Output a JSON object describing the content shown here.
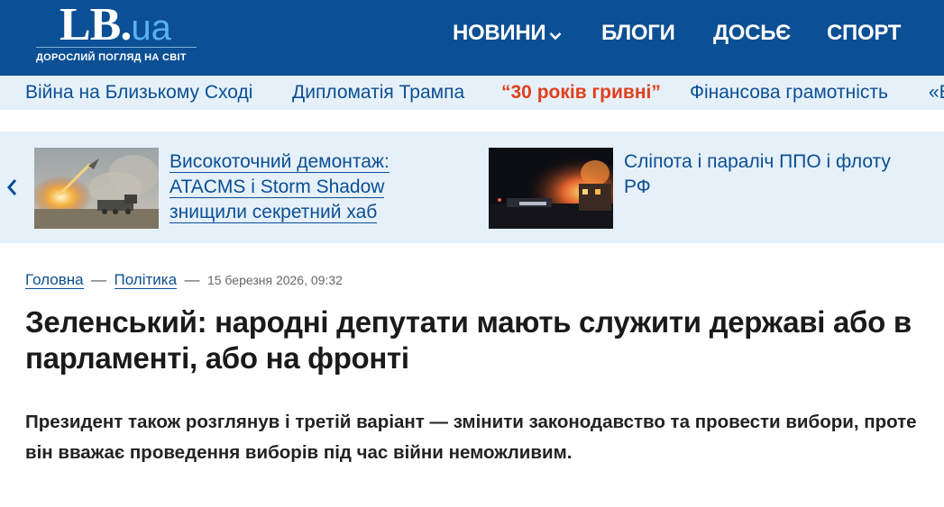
{
  "header": {
    "logo_main": "LB",
    "logo_dot": ".",
    "logo_ua": "ua",
    "logo_tagline": "ДОРОСЛИЙ ПОГЛЯД НА СВІТ",
    "nav": [
      {
        "label": "НОВИНИ",
        "has_dropdown": true
      },
      {
        "label": "БЛОГИ"
      },
      {
        "label": "ДОСЬЄ"
      },
      {
        "label": "СПОРТ"
      }
    ]
  },
  "topics": [
    {
      "label": "Війна на Близькому Сході"
    },
    {
      "label": "Дипломатія Трампа"
    },
    {
      "label": "“30 років гривні”",
      "highlight": true
    },
    {
      "label": "Фінансова грамотність"
    },
    {
      "label": "«Б"
    }
  ],
  "carousel": {
    "prev_icon": "chevron-left-icon",
    "items": [
      {
        "lines": [
          "Високоточний демонтаж:",
          "ATACMS і Storm Shadow",
          "знищили секретний хаб"
        ],
        "image": "rocket-launch-photo"
      },
      {
        "lines": [
          "Сліпота і параліч ППО і флоту",
          "РФ"
        ],
        "image": "night-fire-photo"
      }
    ]
  },
  "breadcrumb": {
    "home": "Головна",
    "separator": "—",
    "section": "Політика",
    "date": "15 березня 2026, 09:32"
  },
  "article": {
    "headline": "Зеленський: народні депутати мають служити державі або в парламенті, або на фронті",
    "lead": "Президент також розглянув і третій варіант — змінити законодавство та провести вибори, проте він вважає проведення виборів під час війни неможливим."
  },
  "colors": {
    "header_bg": "#0b4f94",
    "topics_bg": "#e6f0f9",
    "link": "#0b4f94",
    "highlight": "#e0401c",
    "logo_accent": "#5ab1ef"
  }
}
